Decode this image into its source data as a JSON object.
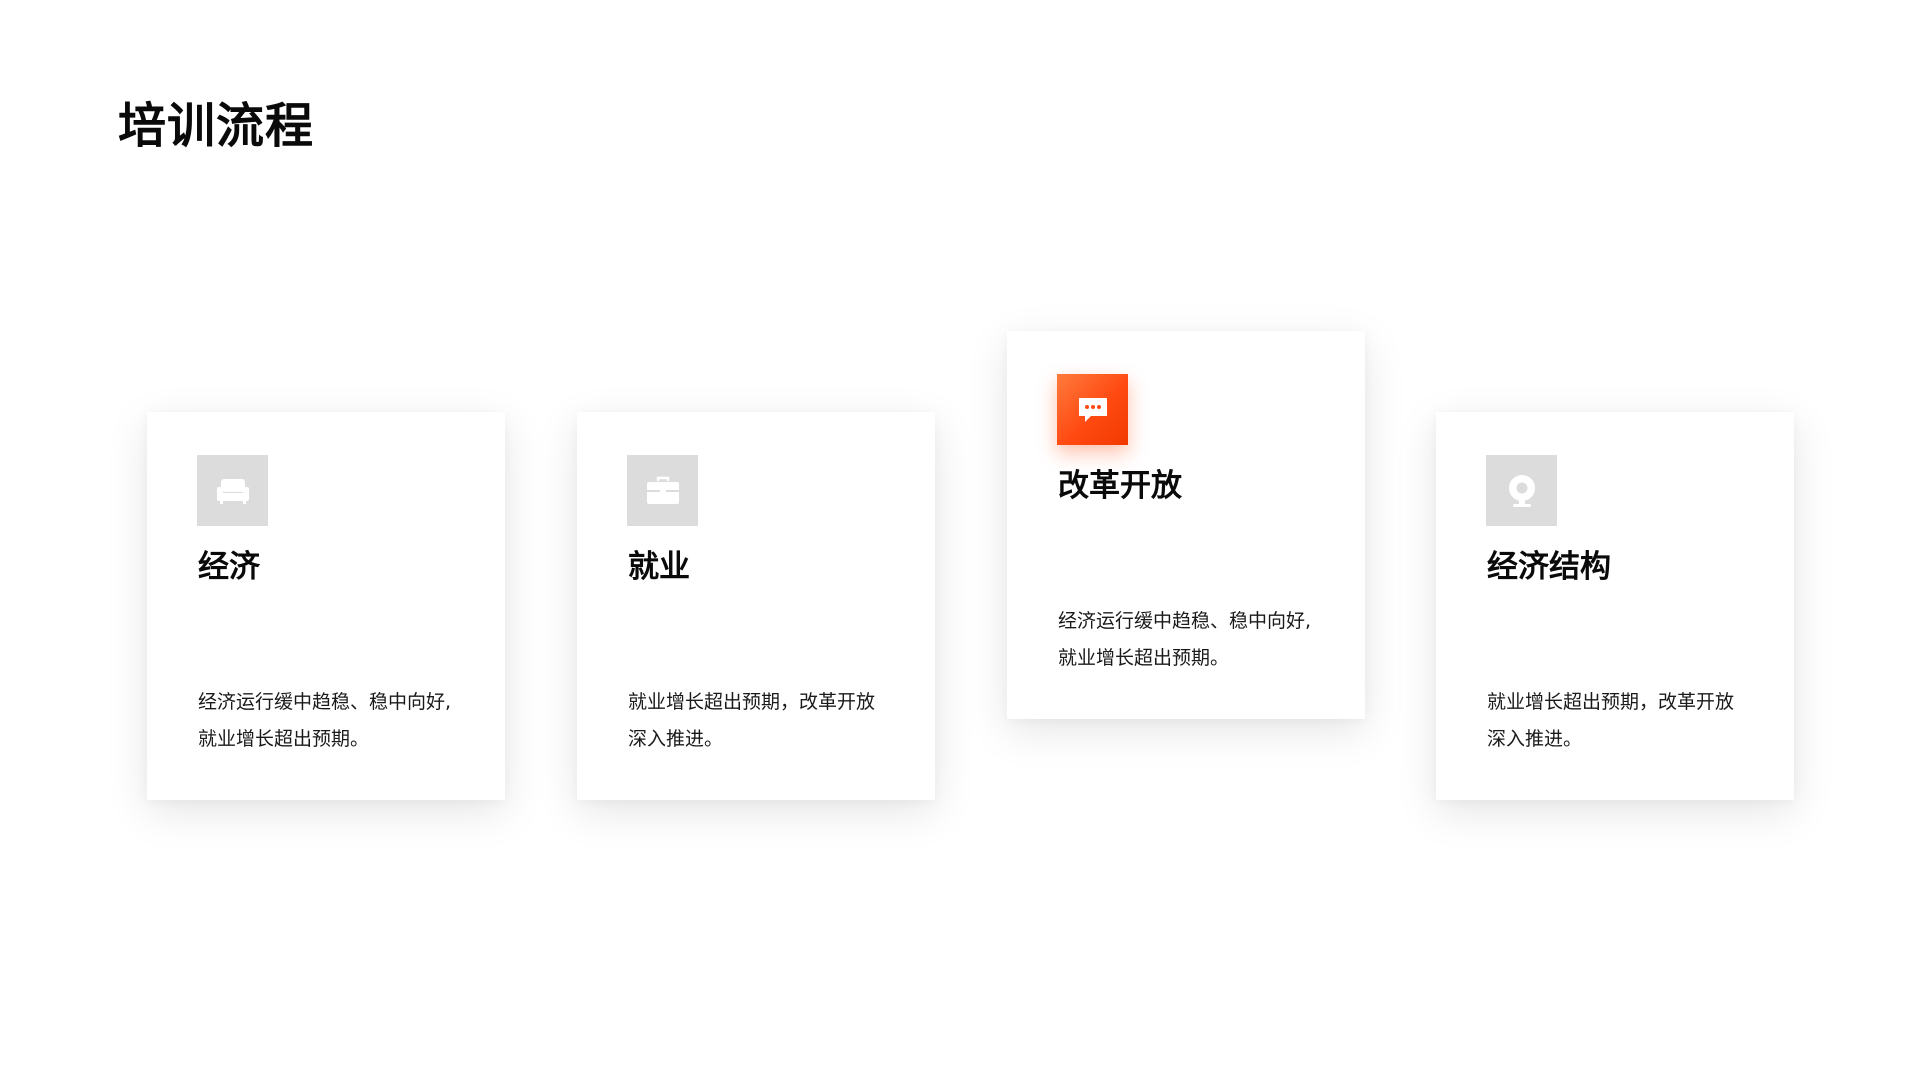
{
  "page": {
    "title": "培训流程"
  },
  "colors": {
    "accent": "#ff4a12",
    "icon_inactive": "#dcdcdc"
  },
  "cards": [
    {
      "title": "经济",
      "description": "经济运行缓中趋稳、稳中向好,就业增长超出预期。",
      "icon": "sofa-icon",
      "active": false
    },
    {
      "title": "就业",
      "description": "就业增长超出预期，改革开放深入推进。",
      "icon": "briefcase-icon",
      "active": false
    },
    {
      "title": "改革开放",
      "description": "经济运行缓中趋稳、稳中向好,就业增长超出预期。",
      "icon": "chat-bubble-icon",
      "active": true
    },
    {
      "title": "经济结构",
      "description": "就业增长超出预期，改革开放深入推进。",
      "icon": "webcam-icon",
      "active": false
    }
  ]
}
